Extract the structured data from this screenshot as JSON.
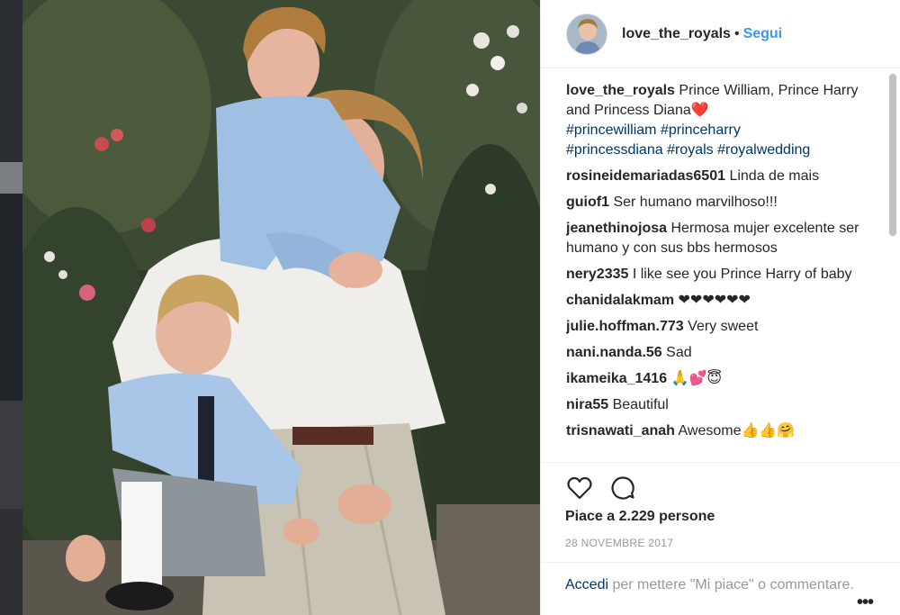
{
  "post": {
    "username": "love_the_royals",
    "separator": "•",
    "follow_label": "Segui",
    "caption_user": "love_the_royals",
    "caption_text": "Prince William, Prince Harry and Princess Diana",
    "caption_emoji": "❤️",
    "hashtags": [
      "#princewilliam",
      "#princeharry",
      "#princessdiana",
      "#royals",
      "#royalwedding"
    ],
    "likes_text": "Piace a 2.229 persone",
    "date": "28 NOVEMBRE 2017",
    "login_link": "Accedi",
    "login_rest": " per mettere \"Mi piace\" o commentare.",
    "more_label": "•••"
  },
  "comments": [
    {
      "user": "rosineidemariadas6501",
      "text": "Linda de mais"
    },
    {
      "user": "guiof1",
      "text": "Ser humano marvilhoso!!!"
    },
    {
      "user": "jeanethinojosa",
      "text": "Hermosa mujer excelente ser humano y con sus bbs hermosos"
    },
    {
      "user": "nery2335",
      "text": "I like see you Prince Harry of baby"
    },
    {
      "user": "chanidalakmam",
      "text": "❤❤❤❤❤❤"
    },
    {
      "user": "julie.hoffman.773",
      "text": "Very sweet"
    },
    {
      "user": "nani.nanda.56",
      "text": "Sad"
    },
    {
      "user": "ikameika_1416",
      "text": "🙏💕😇"
    },
    {
      "user": "nira55",
      "text": "Beautiful"
    },
    {
      "user": "trisnawati_anah",
      "text": "Awesome👍👍🤗"
    }
  ],
  "icons": {
    "like": "heart-icon",
    "comment": "comment-bubble-icon",
    "more": "more-options-icon"
  },
  "colors": {
    "link": "#3897f0",
    "hashtag": "#003569",
    "muted": "#999999",
    "text": "#262626"
  }
}
